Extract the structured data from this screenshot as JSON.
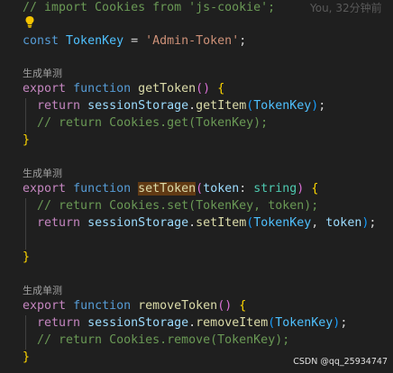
{
  "editor": {
    "blame_text": "You, 32分钟前",
    "code_lens_label": "生成单测",
    "watermark": "CSDN @qq_25934747",
    "lines": {
      "l0": {
        "cmt": "// import Cookies from 'js-cookie';"
      },
      "l2": {
        "k": "const",
        "c": "TokenKey",
        "eq": " = ",
        "s": "'Admin-Token'",
        "semi": ";"
      },
      "l5": {
        "kw1": "export",
        "kw2": "function",
        "fn": "getToken",
        "p": "()",
        "b": "{"
      },
      "l6": {
        "ret": "return",
        "obj": "sessionStorage",
        "dot": ".",
        "fn": "getItem",
        "o": "(",
        "arg": "TokenKey",
        "c": ")",
        "semi": ";"
      },
      "l7": {
        "cmt": "// return Cookies.get(TokenKey);"
      },
      "l8": {
        "b": "}"
      },
      "l11": {
        "kw1": "export",
        "kw2": "function",
        "fn": "setToken",
        "o": "(",
        "param": "token",
        "colon": ": ",
        "typ": "string",
        "c": ")",
        "b": "{"
      },
      "l12": {
        "cmt": "// return Cookies.set(TokenKey, token);"
      },
      "l13": {
        "ret": "return",
        "obj": "sessionStorage",
        "dot": ".",
        "fn": "setItem",
        "o": "(",
        "arg1": "TokenKey",
        "comma": ", ",
        "arg2": "token",
        "c": ")",
        "semi": ";"
      },
      "l15": {
        "b": "}"
      },
      "l18": {
        "kw1": "export",
        "kw2": "function",
        "fn": "removeToken",
        "p": "()",
        "b": "{"
      },
      "l19": {
        "ret": "return",
        "obj": "sessionStorage",
        "dot": ".",
        "fn": "removeItem",
        "o": "(",
        "arg": "TokenKey",
        "c": ")",
        "semi": ";"
      },
      "l20": {
        "cmt": "// return Cookies.remove(TokenKey);"
      },
      "l21": {
        "b": "}"
      }
    }
  },
  "colors": {
    "background": "#1f1f1f",
    "comment": "#6a9955",
    "keyword": "#569cd6",
    "function": "#dcdcaa",
    "string": "#ce9178",
    "highlight": "#613a14"
  },
  "icons": {
    "lightbulb": "lightbulb-icon"
  }
}
